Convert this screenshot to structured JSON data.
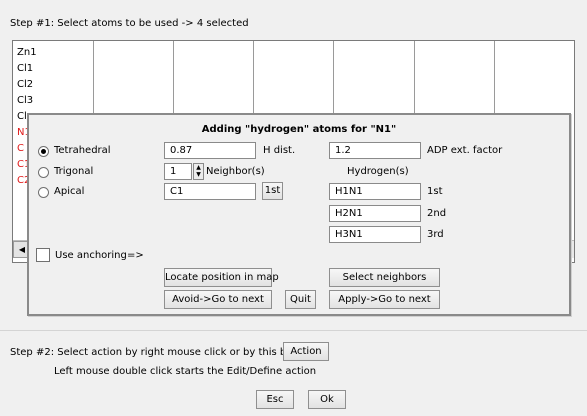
{
  "step1": {
    "text": "Step #1: Select atoms to be used  -> 4 selected"
  },
  "atoms": {
    "zn1": "Zn1",
    "cl1": "Cl1",
    "cl2": "Cl2",
    "cl3": "Cl3",
    "cl4": "Cl",
    "n1": "N1",
    "c_partial_1": "C",
    "c_partial_2": "C1",
    "c_partial_3": "C2"
  },
  "colors": {
    "selected_atom": "#e01818"
  },
  "dialog": {
    "title": "Adding \"hydrogen\" atoms for \"N1\"",
    "geometry_options": [
      {
        "label": "Tetrahedral",
        "selected": true
      },
      {
        "label": "Trigonal",
        "selected": false
      },
      {
        "label": "Apical",
        "selected": false
      }
    ],
    "h_dist_value": "0.87",
    "h_dist_label": "H dist.",
    "neighbors_value": "1",
    "neighbors_label": "Neighbor(s)",
    "apical_atom_value": "C1",
    "first_button": "1st",
    "adp_value": "1.2",
    "adp_label": "ADP ext. factor",
    "hydrogens_header": "Hydrogen(s)",
    "hydrogens": [
      {
        "name": "H1N1",
        "order": "1st"
      },
      {
        "name": "H2N1",
        "order": "2nd"
      },
      {
        "name": "H3N1",
        "order": "3rd"
      }
    ],
    "use_anchoring_label": "Use anchoring",
    "use_anchoring_arrow": "=>",
    "locate_button": "Locate position in map",
    "select_neighbors_button": "Select neighbors",
    "avoid_button": "Avoid->Go to next",
    "quit_button": "Quit",
    "apply_button": "Apply->Go to next"
  },
  "step2": {
    "text": "Step #2: Select action by right mouse click or by this button:",
    "action_button": "Action",
    "hint": "Left mouse double click starts the Edit/Define action"
  },
  "footer": {
    "esc_button": "Esc",
    "ok_button": "Ok"
  }
}
